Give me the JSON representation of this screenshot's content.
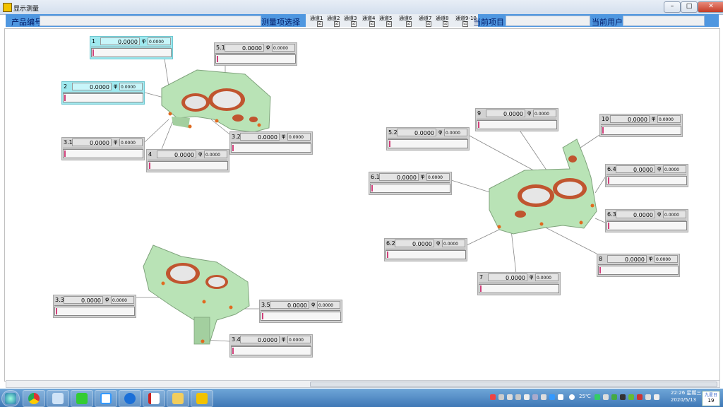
{
  "window": {
    "title": "显示测量",
    "minimize_icon": "minimize-icon",
    "maximize_icon": "maximize-icon",
    "close_icon": "close-icon"
  },
  "header": {
    "product_no_label": "产品编号",
    "product_no_value": "",
    "measure_select_label": "测量项选择",
    "channels": [
      "通道1",
      "通道2",
      "通道3",
      "通道4",
      "通道5",
      "通道6",
      "通道7",
      "通道8",
      "通道9-10"
    ],
    "channel_checked": "☑",
    "current_item_label": "当前项目",
    "current_item_value": "",
    "current_user_label": "当前用户",
    "current_user_value": ""
  },
  "phi_symbol": "φ",
  "measurements": [
    {
      "id": "1",
      "value": "0.0000",
      "phi": "0.0000",
      "level": 0
    },
    {
      "id": "2",
      "value": "0.0000",
      "phi": "0.0000",
      "level": 0
    },
    {
      "id": "3.1",
      "value": "0.0000",
      "phi": "0.0000",
      "level": 0
    },
    {
      "id": "4",
      "value": "0.0000",
      "phi": "0.0000",
      "level": 0
    },
    {
      "id": "5.1",
      "value": "0.0000",
      "phi": "0.0000",
      "level": 0
    },
    {
      "id": "3.2",
      "value": "0.0000",
      "phi": "0.0000",
      "level": 0
    },
    {
      "id": "3.3",
      "value": "0.0000",
      "phi": "0.0000",
      "level": 0
    },
    {
      "id": "3.5",
      "value": "0.0000",
      "phi": "0.0000",
      "level": 0
    },
    {
      "id": "3.4",
      "value": "0.0000",
      "phi": "0.0000",
      "level": 0
    },
    {
      "id": "9",
      "value": "0.0000",
      "phi": "0.0000",
      "level": 0
    },
    {
      "id": "10",
      "value": "0.0000",
      "phi": "0.0000",
      "level": 0
    },
    {
      "id": "5.2",
      "value": "0.0000",
      "phi": "0.0000",
      "level": 0
    },
    {
      "id": "6.1",
      "value": "0.0000",
      "phi": "0.0000",
      "level": 0
    },
    {
      "id": "6.4",
      "value": "0.0000",
      "phi": "0.0000",
      "level": 0
    },
    {
      "id": "6.3",
      "value": "0.0000",
      "phi": "0.0000",
      "level": 0
    },
    {
      "id": "6.2",
      "value": "0.0000",
      "phi": "0.0000",
      "level": 0
    },
    {
      "id": "8",
      "value": "0.0000",
      "phi": "0.0000",
      "level": 0
    },
    {
      "id": "7",
      "value": "0.0000",
      "phi": "0.0000",
      "level": 0
    }
  ],
  "taskbar": {
    "apps": [
      "start-orb-icon",
      "chrome-icon",
      "notepad-icon",
      "iqiyi-icon",
      "baidu-netdisk-icon",
      "kuwo-icon",
      "pdf-icon",
      "explorer-icon",
      "labview-icon"
    ],
    "weather": "25℃",
    "time": "22:26 星期三",
    "date": "2020/5/13",
    "calendar_title": "九星日",
    "calendar_day": "19"
  },
  "colors": {
    "header_blue": "#4f97e0",
    "part_green": "#b9e3b6",
    "part_copper": "#c0552f",
    "selected_cyan": "#9fe9ef"
  }
}
